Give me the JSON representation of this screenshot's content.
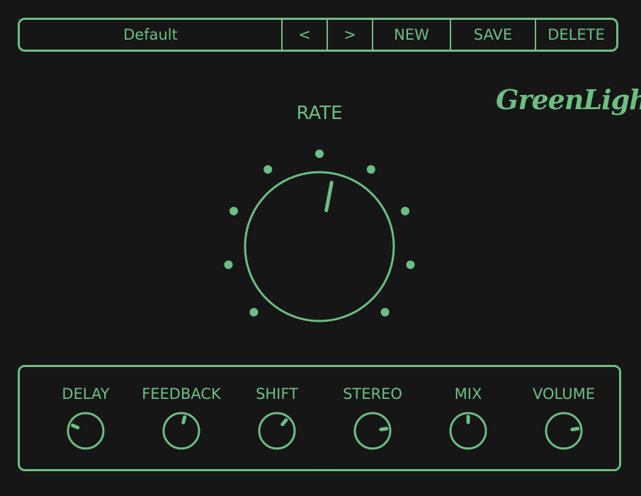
{
  "colors": {
    "accent": "#6dbf83",
    "background": "#161616"
  },
  "preset_bar": {
    "preset_name": "Default",
    "prev_label": "<",
    "next_label": ">",
    "new_label": "NEW",
    "save_label": "SAVE",
    "delete_label": "DELETE"
  },
  "logo": {
    "text": "GreenLight"
  },
  "rate": {
    "label": "RATE",
    "value": 0.54,
    "scale_dots": 9
  },
  "knobs": [
    {
      "label": "DELAY",
      "value": 0.25
    },
    {
      "label": "FEEDBACK",
      "value": 0.55
    },
    {
      "label": "SHIFT",
      "value": 0.65
    },
    {
      "label": "STEREO",
      "value": 0.8
    },
    {
      "label": "MIX",
      "value": 0.5
    },
    {
      "label": "VOLUME",
      "value": 0.8
    }
  ]
}
